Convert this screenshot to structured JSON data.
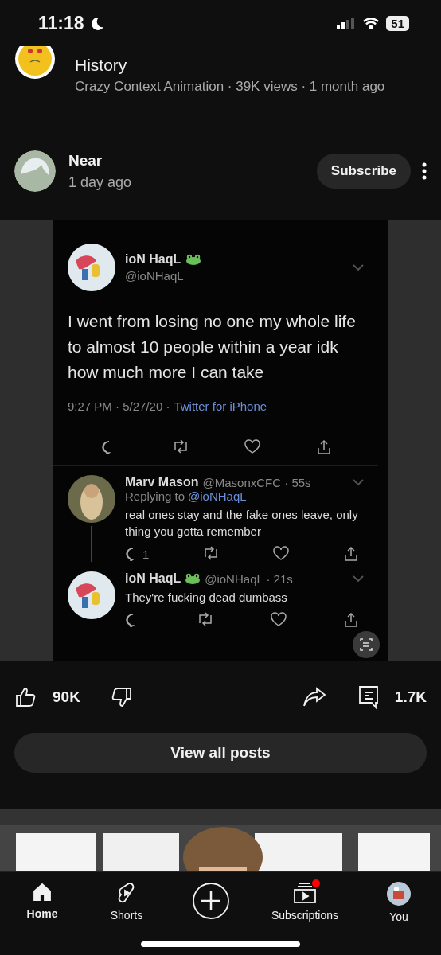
{
  "status_bar": {
    "time": "11:18",
    "battery": "51"
  },
  "previous_video": {
    "title": "History",
    "meta": "Crazy Context Animation · 39K views · 1 month ago"
  },
  "post": {
    "author": "Near",
    "age": "1 day ago",
    "subscribe": "Subscribe",
    "tweet": {
      "name": "ioN HaqL",
      "frog": true,
      "handle": "@ioNHaqL",
      "text": "I went from losing no one my whole life to almost 10 people within a year idk how much more I can take",
      "time": "9:27 PM · 5/27/20 ·",
      "source": "Twitter for iPhone"
    },
    "replies": [
      {
        "name": "Marv Mason",
        "frog": false,
        "handle": "@MasonxCFC · 55s",
        "replying_label": "Replying to",
        "replying_to": "@ioNHaqL",
        "text": "real ones stay and the fake ones leave, only thing you gotta remember",
        "reply_count": "1",
        "thread": true
      },
      {
        "name": "ioN HaqL",
        "frog": true,
        "handle": "@ioNHaqL · 21s",
        "text": "They're fucking dead dumbass",
        "thread": false
      }
    ],
    "likes": "90K",
    "comments": "1.7K",
    "view_all": "View all posts"
  },
  "nav": [
    {
      "kind": "home",
      "label": "Home",
      "selected": true
    },
    {
      "kind": "shorts",
      "label": "Shorts",
      "selected": false
    },
    {
      "kind": "create",
      "selected": false
    },
    {
      "kind": "subscriptions",
      "label": "Subscriptions",
      "selected": false,
      "has_new": true
    },
    {
      "kind": "you",
      "label": "You",
      "selected": false
    }
  ]
}
